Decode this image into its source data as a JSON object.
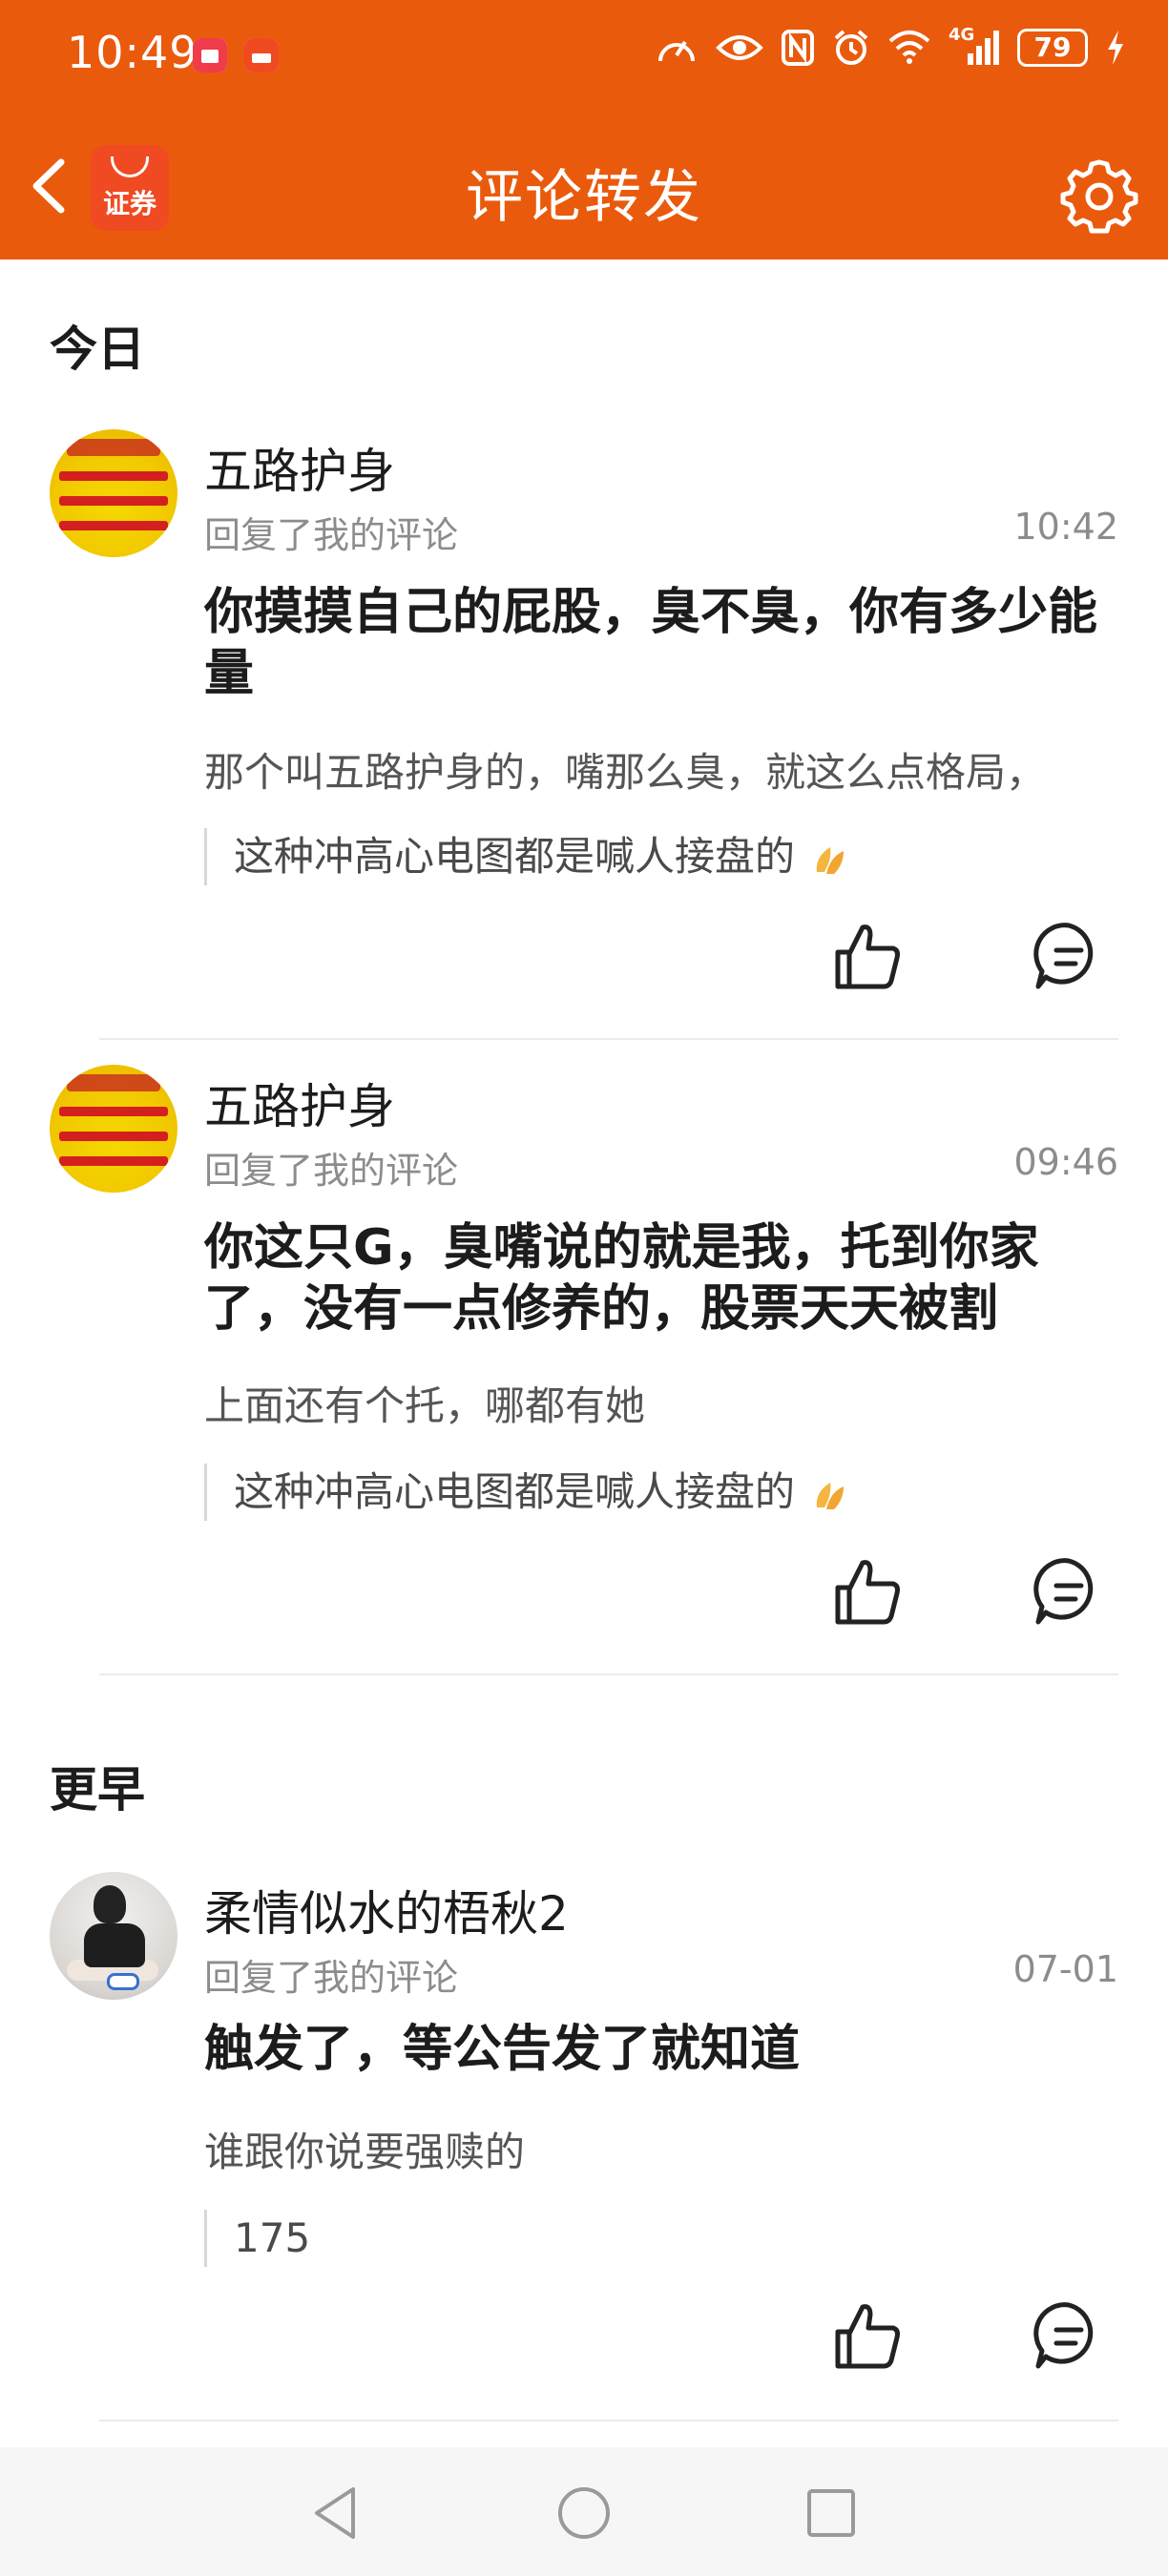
{
  "status_bar": {
    "time": "10:49",
    "network": "4G",
    "battery": "79",
    "app_badges": [
      "huawei-app-icon",
      "securities-app-icon"
    ]
  },
  "header": {
    "title": "评论转发",
    "logo_text": "证券",
    "back_icon": "chevron-left-icon",
    "settings_icon": "gear-icon"
  },
  "sections": [
    {
      "title": "今日",
      "items": [
        {
          "username": "五路护身",
          "action": "回复了我的评论",
          "time": "10:42",
          "reply": "你摸摸自己的屁股，臭不臭，你有多少能量",
          "context": "那个叫五路护身的，嘴那么臭，就这么点格局，",
          "quote": "这种冲高心电图都是喊人接盘的"
        },
        {
          "username": "五路护身",
          "action": "回复了我的评论",
          "time": "09:46",
          "reply": "你这只G，臭嘴说的就是我，托到你家了，没有一点修养的，股票天天被割",
          "context": "上面还有个托，哪都有她",
          "quote": "这种冲高心电图都是喊人接盘的"
        }
      ]
    },
    {
      "title": "更早",
      "items": [
        {
          "username": "柔情似水的梧秋2",
          "action": "回复了我的评论",
          "time": "07-01",
          "reply": "触发了，等公告发了就知道",
          "context": "谁跟你说要强赎的",
          "quote": "175"
        }
      ]
    }
  ],
  "colors": {
    "accent": "#ea5a0c",
    "secondary_text": "#8c8c8c"
  }
}
